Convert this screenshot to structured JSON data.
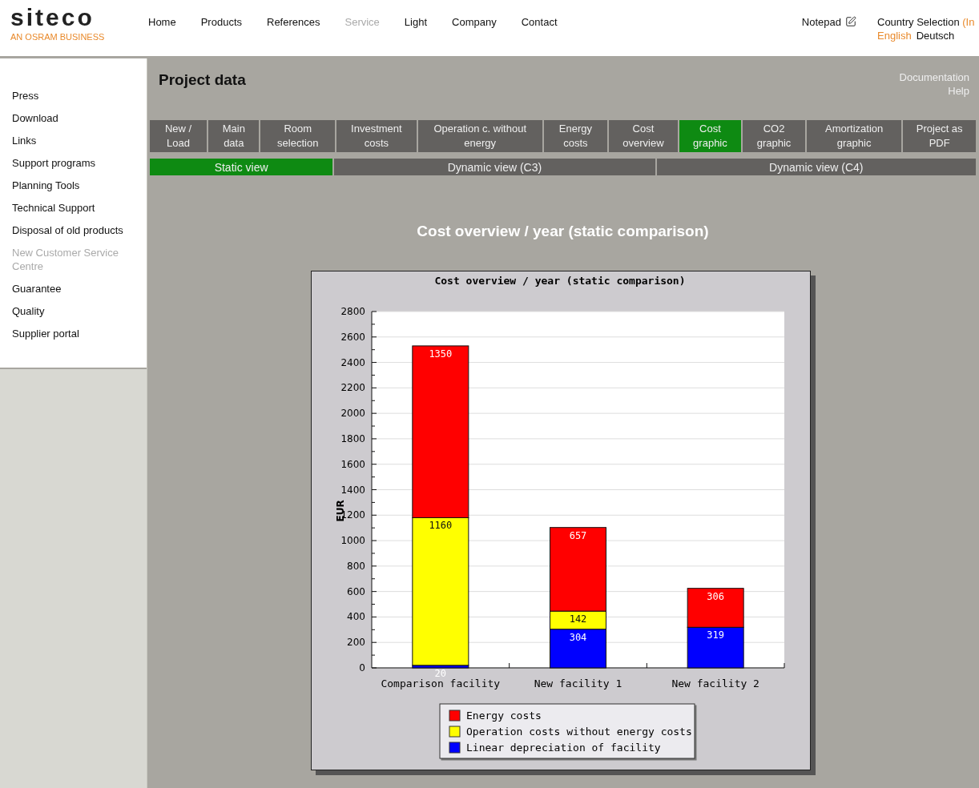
{
  "header": {
    "logo": "siteco",
    "tagline": "AN OSRAM BUSINESS",
    "nav": [
      {
        "label": "Home",
        "selected": false
      },
      {
        "label": "Products",
        "selected": false
      },
      {
        "label": "References",
        "selected": false
      },
      {
        "label": "Service",
        "selected": true
      },
      {
        "label": "Light",
        "selected": false
      },
      {
        "label": "Company",
        "selected": false
      },
      {
        "label": "Contact",
        "selected": false
      }
    ],
    "notepad": "Notepad",
    "country_label": "Country Selection",
    "country_suffix": "(In",
    "languages": [
      {
        "label": "English",
        "selected": false
      },
      {
        "label": "Deutsch",
        "selected": true
      }
    ]
  },
  "sidebar": {
    "items": [
      {
        "label": "Press",
        "selected": false
      },
      {
        "label": "Download",
        "selected": false
      },
      {
        "label": "Links",
        "selected": false
      },
      {
        "label": "Support programs",
        "selected": false
      },
      {
        "label": "Planning Tools",
        "selected": false
      },
      {
        "label": "Technical Support",
        "selected": false
      },
      {
        "label": "Disposal of old products",
        "selected": false
      },
      {
        "label": "New Customer Service Centre",
        "selected": true
      },
      {
        "label": "Guarantee",
        "selected": false
      },
      {
        "label": "Quality",
        "selected": false
      },
      {
        "label": "Supplier portal",
        "selected": false
      }
    ]
  },
  "main": {
    "title": "Project data",
    "links": [
      "Documentation",
      "Help"
    ],
    "tabs": [
      {
        "label": "New / Load",
        "selected": false
      },
      {
        "label": "Main data",
        "selected": false
      },
      {
        "label": "Room selection",
        "selected": false
      },
      {
        "label": "Investment costs",
        "selected": false
      },
      {
        "label": "Operation c. without energy",
        "selected": false
      },
      {
        "label": "Energy costs",
        "selected": false
      },
      {
        "label": "Cost overview",
        "selected": false
      },
      {
        "label": "Cost graphic",
        "selected": true
      },
      {
        "label": "CO2 graphic",
        "selected": false
      },
      {
        "label": "Amortization graphic",
        "selected": false
      },
      {
        "label": "Project as PDF",
        "selected": false
      }
    ],
    "views": [
      {
        "label": "Static view",
        "selected": true
      },
      {
        "label": "Dynamic view (C3)",
        "selected": false
      },
      {
        "label": "Dynamic view (C4)",
        "selected": false
      }
    ],
    "heading": "Cost overview / year (static comparison)",
    "chart_data": {
      "type": "bar",
      "title": "Cost overview / year (static comparison)",
      "ylabel": "EUR",
      "stacked": true,
      "data_labels": true,
      "categories": [
        "Comparison facility",
        "New facility 1",
        "New facility 2"
      ],
      "series": [
        {
          "name": "Linear depreciation of facility",
          "color": "#0000ff",
          "values": [
            20,
            304,
            319
          ]
        },
        {
          "name": "Operation costs without energy costs",
          "color": "#ffff00",
          "values": [
            1160,
            142,
            null
          ]
        },
        {
          "name": "Energy costs",
          "color": "#ff0000",
          "values": [
            1350,
            657,
            306
          ]
        }
      ],
      "ylim": [
        0,
        2800
      ],
      "yticks": [
        0,
        200,
        400,
        600,
        800,
        1000,
        1200,
        1400,
        1600,
        1800,
        2000,
        2200,
        2400,
        2600,
        2800
      ],
      "grid": true,
      "legend": true
    }
  }
}
